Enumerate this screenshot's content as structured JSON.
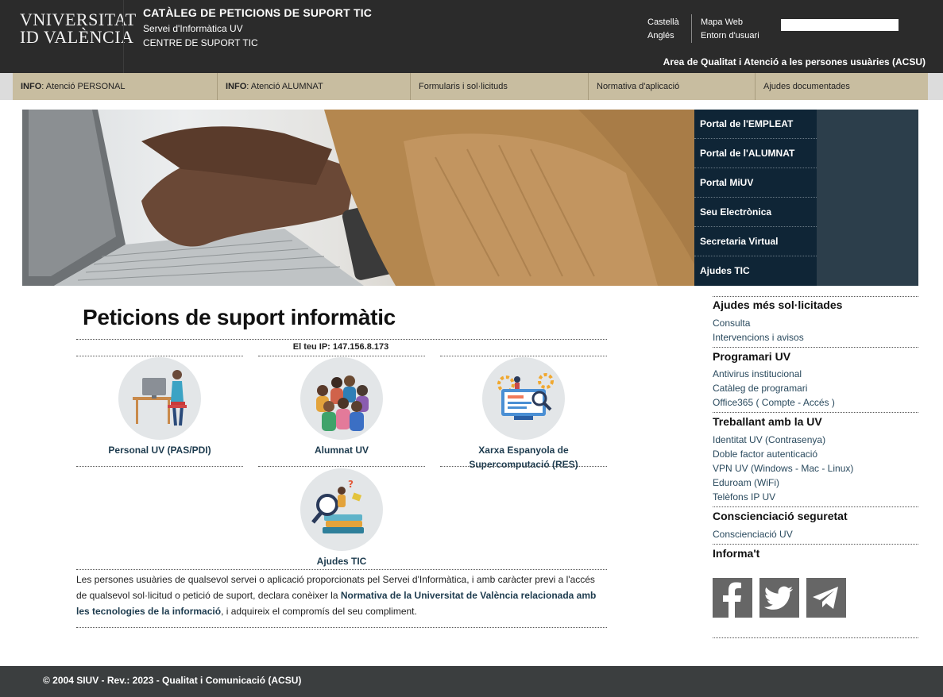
{
  "header": {
    "logo_line1": "VNIVERSITAT",
    "logo_line2": "ID VALÈNCIA",
    "title": "CATÀLEG DE PETICIONS DE SUPORT TIC",
    "subtitle1": "Servei d'Informàtica UV",
    "subtitle2": "CENTRE DE SUPORT TIC",
    "lang_castella": "Castellà",
    "lang_angles": "Anglés",
    "link_mapa": "Mapa Web",
    "link_entorn": "Entorn d'usuari",
    "search_placeholder": "",
    "acsu": "Area de Qualitat i Atenció a les persones usuàries (ACSU)"
  },
  "nav": {
    "item1_bold": "INFO",
    "item1_rest": ": Atenció PERSONAL",
    "item2_bold": "INFO",
    "item2_rest": ": Atenció ALUMNAT",
    "item3": "Formularis i sol·licituds",
    "item4": "Normativa d'aplicació",
    "item5": "Ajudes documentades"
  },
  "portals": [
    "Portal de l'EMPLEAT",
    "Portal de l'ALUMNAT",
    "Portal MiUV",
    "Seu Electrònica",
    "Secretaria Virtual",
    "Ajudes TIC"
  ],
  "main": {
    "title": "Peticions de suport informàtic",
    "ip": "El teu IP: 147.156.8.173",
    "tile_personal": "Personal UV (PAS/PDI)",
    "tile_alumnat": "Alumnat UV",
    "tile_res": "Xarxa Espanyola de Supercomputació (RES)",
    "tile_ajudes": "Ajudes TIC",
    "notice_pre": "Les persones usuàries de qualsevol servei o aplicació proporcionats pel Servei d'Informàtica, i amb caràcter previ a l'accés de qualsevol sol·licitud o petició de suport, declara conèixer la ",
    "notice_link": "Normativa de la Universitat de València relacionada amb les tecnologies de la informació",
    "notice_post": ", i adquireix el compromís del seu compliment."
  },
  "sidebar": {
    "h_ajudes": "Ajudes més sol·licitades",
    "l_consulta": "Consulta",
    "l_intervencions": "Intervencions i avisos",
    "h_programari": "Programari UV",
    "l_antivirus": "Antivirus institucional",
    "l_cataleg": "Catàleg de programari",
    "l_office": "Office365 ( Compte - Accés )",
    "h_treballant": "Treballant amb la UV",
    "l_identitat": "Identitat UV (Contrasenya)",
    "l_doble": "Doble factor autenticació",
    "l_vpn": "VPN UV (Windows - Mac - Linux)",
    "l_eduroam": "Eduroam (WiFi)",
    "l_telefons": "Telèfons IP UV",
    "h_consciencia": "Conscienciació seguretat",
    "l_consciencia": "Conscienciació UV",
    "h_informat": "Informa't"
  },
  "social_icons": [
    "facebook-icon",
    "twitter-icon",
    "telegram-icon"
  ],
  "footer": {
    "text": "© 2004 SIUV - Rev.: 2023 - Qualitat i Comunicació (ACSU)"
  },
  "colors": {
    "header_bg": "#2b2b2b",
    "nav_bg": "#c8bda0",
    "portal_bg": "#0f2536",
    "link": "#1d3b4e",
    "footer_bg": "#3b3e3f"
  }
}
